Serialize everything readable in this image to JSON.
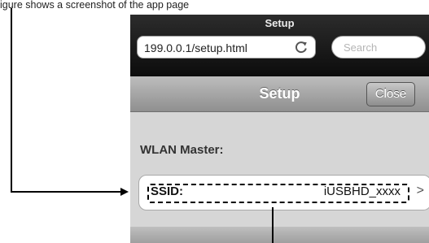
{
  "caption": "igure shows a screenshot of the app page",
  "browser": {
    "title": "Setup",
    "url": "199.0.0.1/setup.html",
    "search_placeholder": "Search"
  },
  "navbar": {
    "title": "Setup",
    "close_label": "Close"
  },
  "section": {
    "label": "WLAN Master:"
  },
  "ssid_row": {
    "label": "SSID:",
    "value": "iUSBHD_xxxx",
    "chevron": ">"
  }
}
